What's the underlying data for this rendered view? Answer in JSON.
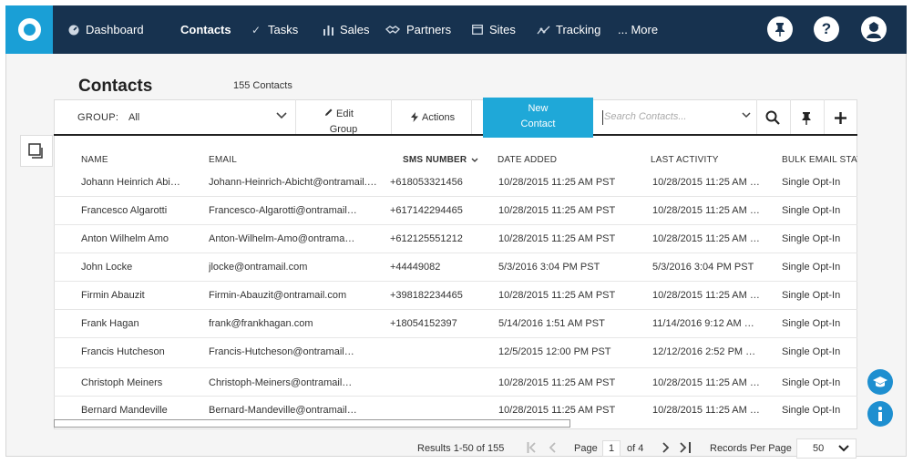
{
  "nav": {
    "items": [
      {
        "label": "Dashboard",
        "icon": "dashboard-icon"
      },
      {
        "label": "Contacts",
        "icon": ""
      },
      {
        "label": "Tasks",
        "icon": "check-icon"
      },
      {
        "label": "Sales",
        "icon": "bar-chart-icon"
      },
      {
        "label": "Partners",
        "icon": "handshake-icon"
      },
      {
        "label": "Sites",
        "icon": "window-icon"
      },
      {
        "label": "Tracking",
        "icon": "line-graph-icon"
      },
      {
        "label": "... More",
        "icon": ""
      }
    ],
    "active": "Contacts",
    "help_glyph": "?"
  },
  "page": {
    "title": "Contacts",
    "count_text": "155 Contacts"
  },
  "toolbar": {
    "group_label": "GROUP:",
    "group_value": "All",
    "edit_group_line1": "Edit",
    "edit_group_line2": "Group",
    "actions_label": "Actions",
    "new_contact_line1": "New",
    "new_contact_line2": "Contact",
    "search_placeholder": "Search Contacts..."
  },
  "table": {
    "columns": [
      "NAME",
      "EMAIL",
      "SMS NUMBER",
      "DATE ADDED",
      "LAST ACTIVITY",
      "BULK EMAIL STAT"
    ],
    "sorted_column": "SMS NUMBER",
    "rows": [
      [
        "Johann Heinrich Abi…",
        "Johann-Heinrich-Abicht@ontramail.…",
        "+618053321456",
        "10/28/2015 11:25 AM PST",
        "10/28/2015 11:25 AM …",
        "Single Opt-In"
      ],
      [
        "Francesco Algarotti",
        "Francesco-Algarotti@ontramail…",
        "+617142294465",
        "10/28/2015 11:25 AM PST",
        "10/28/2015 11:25 AM …",
        "Single Opt-In"
      ],
      [
        "Anton Wilhelm Amo",
        "Anton-Wilhelm-Amo@ontrama…",
        "+612125551212",
        "10/28/2015 11:25 AM PST",
        "10/28/2015 11:25 AM …",
        "Single Opt-In"
      ],
      [
        "John Locke",
        "jlocke@ontramail.com",
        "+44449082",
        "5/3/2016 3:04 PM PST",
        "5/3/2016 3:04 PM PST",
        "Single Opt-In"
      ],
      [
        "Firmin Abauzit",
        "Firmin-Abauzit@ontramail.com",
        "+398182234465",
        "10/28/2015 11:25 AM PST",
        "10/28/2015 11:25 AM …",
        "Single Opt-In"
      ],
      [
        "Frank Hagan",
        "frank@frankhagan.com",
        "+18054152397",
        "5/14/2016 1:51 AM PST",
        "11/14/2016 9:12 AM …",
        "Single Opt-In"
      ],
      [
        "Francis Hutcheson",
        "Francis-Hutcheson@ontramail…",
        "",
        "12/5/2015 12:00 PM PST",
        "12/12/2016 2:52 PM …",
        "Single Opt-In"
      ],
      [
        "Christoph Meiners",
        "Christoph-Meiners@ontramail…",
        "",
        "10/28/2015 11:25 AM PST",
        "10/28/2015 11:25 AM …",
        "Single Opt-In"
      ],
      [
        "Bernard Mandeville",
        "Bernard-Mandeville@ontramail…",
        "",
        "10/28/2015 11:25 AM PST",
        "10/28/2015 11:25 AM …",
        "Single Opt-In"
      ]
    ]
  },
  "pagination": {
    "results_text": "Results 1-50 of 155",
    "page_label": "Page",
    "current_page": "1",
    "of_text": "of 4",
    "records_label": "Records Per Page",
    "records_value": "50"
  },
  "colors": {
    "nav_bg": "#17324f",
    "accent": "#1fa8d8",
    "help_blue": "#1e8fd0"
  }
}
